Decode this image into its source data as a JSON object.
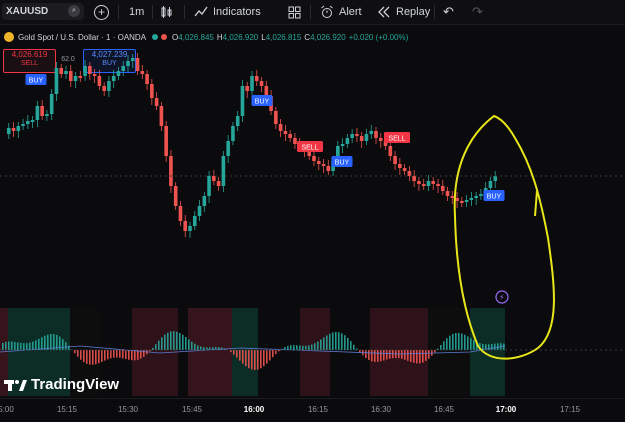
{
  "toolbar": {
    "symbol": "XAUUSD",
    "interval": "1m",
    "indicators_label": "Indicators",
    "alert_label": "Alert",
    "replay_label": "Replay"
  },
  "legend": {
    "title": "Gold Spot / U.S. Dollar · 1 · OANDA",
    "o_label": "O",
    "o": "4,026.845",
    "h_label": "H",
    "h": "4,026.920",
    "l_label": "L",
    "l": "4,026.815",
    "c_label": "C",
    "c": "4,026.920",
    "change": "+0.020 (+0.00%)"
  },
  "order": {
    "sell_price": "4,026.619",
    "sell_label": "SELL",
    "spread": "62.0",
    "buy_price": "4,027.239",
    "buy_label": "BUY"
  },
  "signals": [
    {
      "label": "BUY",
      "type": "buy"
    },
    {
      "label": "BUY",
      "type": "buy"
    },
    {
      "label": "SELL",
      "type": "sell"
    },
    {
      "label": "BUY",
      "type": "buy"
    },
    {
      "label": "SELL",
      "type": "sell"
    },
    {
      "label": "BUY",
      "type": "buy"
    }
  ],
  "x_axis": {
    "ticks": [
      "5:00",
      "15:15",
      "15:30",
      "15:45",
      "16:00",
      "16:15",
      "16:30",
      "16:45",
      "17:00",
      "17:15"
    ],
    "bold": [
      "16:00",
      "17:00"
    ]
  },
  "brand": "TradingView",
  "colors": {
    "up": "#26a69a",
    "down": "#ef5350",
    "buy": "#2962ff",
    "sell": "#f23645",
    "annotation": "#e8e619"
  },
  "chart_data": {
    "type": "candlestick",
    "price_level": "4,026.92",
    "note": "Gold 1-minute candles with BUY/SELL signal markers and a histogram oscillator below"
  }
}
